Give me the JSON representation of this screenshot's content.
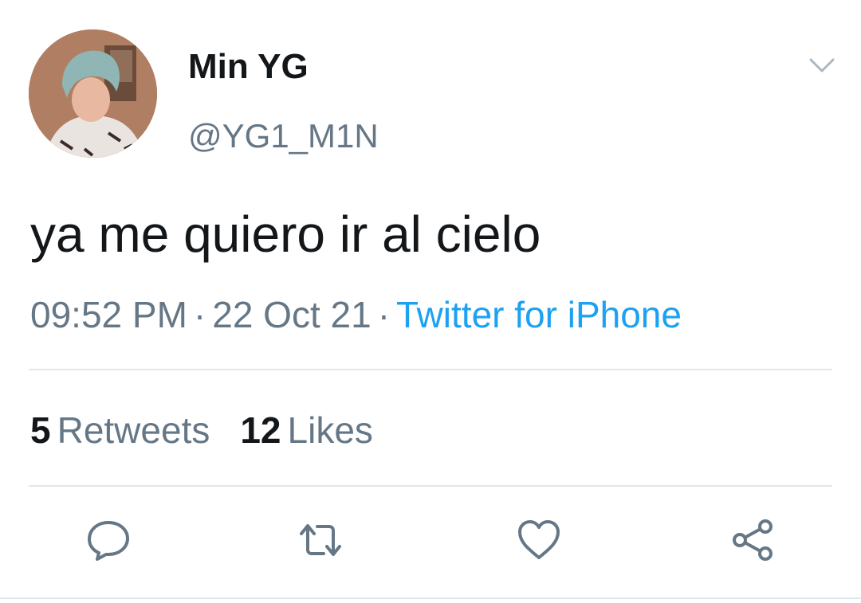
{
  "tweet": {
    "display_name": "Min YG",
    "handle": "@YG1_M1N",
    "text": "ya me quiero ir al cielo",
    "time": "09:52 PM",
    "separator": "·",
    "date": "22 Oct 21",
    "source": "Twitter for iPhone"
  },
  "stats": {
    "retweets_count": "5",
    "retweets_label": "Retweets",
    "likes_count": "12",
    "likes_label": "Likes"
  },
  "icons": {
    "reply": "reply-icon",
    "retweet": "retweet-icon",
    "like": "heart-icon",
    "share": "share-icon",
    "menu": "chevron-down-icon"
  },
  "colors": {
    "text_primary": "#14171a",
    "text_secondary": "#657786",
    "link": "#1da1f2",
    "divider": "#e1e8ed"
  }
}
